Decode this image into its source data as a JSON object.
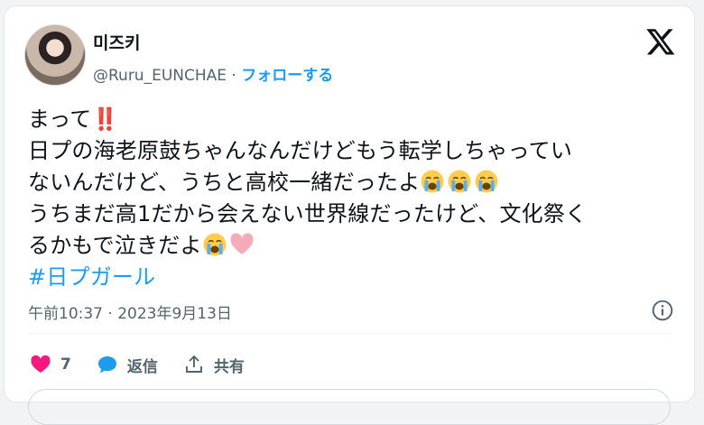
{
  "author": {
    "display_name": "미즈키",
    "handle": "@Ruru_EUNCHAE",
    "separator": " · ",
    "follow_label": "フォローする"
  },
  "tweet": {
    "line1": "まって",
    "line1_emoji": "‼️",
    "line2": "日プの海老原鼓ちゃんなんだけどもう転学しちゃってい",
    "line3": "ないんだけど、うちと高校一緒だったよ",
    "line3_emojis": [
      "loudly-crying-face",
      "loudly-crying-face",
      "loudly-crying-face"
    ],
    "line4": "うちまだ高1だから会えない世界線だったけど、文化祭く",
    "line5": "るかもで泣きだよ",
    "line5_emojis": [
      "loudly-crying-face",
      "pink-heart"
    ],
    "hashtag": "#日プガール"
  },
  "meta": {
    "timestamp": "午前10:37 · 2023年9月13日"
  },
  "actions": {
    "like_count": "7",
    "reply_label": "返信",
    "share_label": "共有"
  },
  "colors": {
    "accent": "#1d9bf0",
    "like": "#f91880",
    "secondary_text": "#536471"
  }
}
